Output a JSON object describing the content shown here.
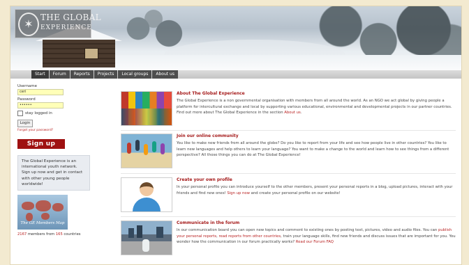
{
  "header": {
    "logo_line1": "THE GLOBAL",
    "logo_line2": "EXPERIENCE"
  },
  "nav": {
    "items": [
      {
        "label": "Start",
        "active": true
      },
      {
        "label": "Forum",
        "active": false
      },
      {
        "label": "Reports",
        "active": false
      },
      {
        "label": "Projects",
        "active": false
      },
      {
        "label": "Local groups",
        "active": false
      },
      {
        "label": "About us",
        "active": false
      }
    ]
  },
  "login": {
    "username_label": "Username",
    "username_value": "ceri",
    "password_label": "Password",
    "password_value": "••••••",
    "stay_logged_label": "stay logged in",
    "login_button": "Login",
    "forgot_link": "Forgot your password?"
  },
  "signup": {
    "label": "Sign up"
  },
  "info": {
    "text": "The Global Experience is an international youth network. Sign up now and get in contact with other young people worldwide!"
  },
  "map": {
    "caption": "The GE Members Map",
    "members_count": "2167",
    "members_mid": " members from ",
    "countries_count": "165",
    "countries_suffix": " countries"
  },
  "sections": [
    {
      "title": "About The Global Experience",
      "text": "The Global Experience is a non governmental organisation with members from all around the world. As an NGO we act global by giving people a platform for intercultural exchange and local by supporting various educational, environmental and developmental projects in our partner countries. Find out more about The Global Experience in the section ",
      "link": "About us"
    },
    {
      "title": "Join our online community",
      "text": "You like to make new friends from all around the globe? Do you like to report from your life and see how people live in other countries? You like to learn new languages and help others to learn your language? You want to make a change to the world and learn how to see things from a different perspective? All those things you can do at The Global Experience!",
      "link": ""
    },
    {
      "title": "Create your own profile",
      "text": "In your personal profile you can introduce yourself to the other members, present your personal reports in a blog, upload pictures, interact with your friends and find new ones! ",
      "link": "Sign up now",
      "text_after": " and create your personal profile on our website!"
    },
    {
      "title": "Communicate in the forum",
      "text_a": "In our communication board you can open new topics and comment to existing ones by posting text, pictures, video and audio files. You can ",
      "link_a": "publish your personal reports",
      "text_b": ", ",
      "link_b": "read reports from other countries",
      "text_c": ", train your language skills, find new friends and discuss issues that are important for you. You wonder how the communication in our forum practically works? ",
      "link_c": "Read our Forum FAQ"
    }
  ],
  "colors": {
    "accent_red": "#a51b1b",
    "nav_bg": "#4d4d4d",
    "input_bg": "#ffffb8",
    "page_bg": "#f3ead0"
  }
}
